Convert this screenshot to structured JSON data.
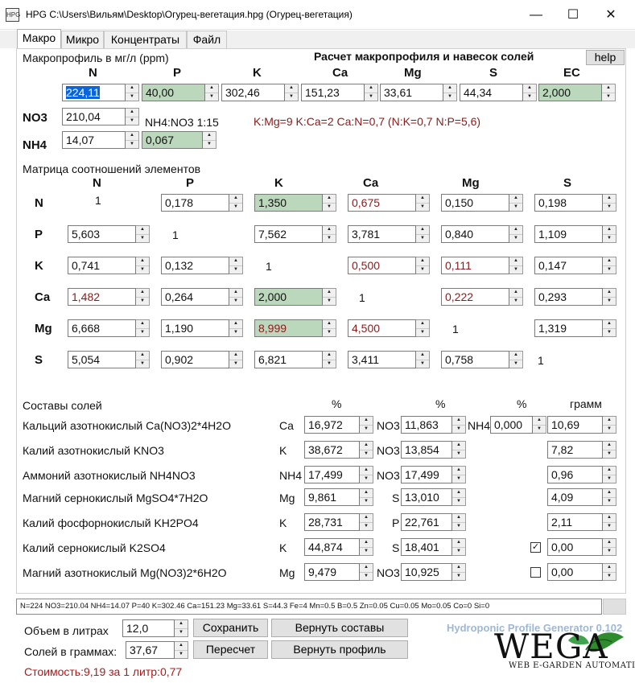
{
  "window": {
    "title": "HPG C:\\Users\\Вильям\\Desktop\\Огурец-вегетация.hpg (Огурец-вегетация)",
    "icon": "app-icon",
    "buttons": {
      "minimize": "—",
      "maximize": "☐",
      "close": "✕"
    }
  },
  "tabs": [
    "Макро",
    "Микро",
    "Концентраты",
    "Файл"
  ],
  "macro": {
    "profile_label": "Макропрофиль в мг/л (ppm)",
    "calc_title": "Расчет макропрофиля и навесок солей",
    "help_label": "help",
    "headers": [
      "N",
      "P",
      "K",
      "Ca",
      "Mg",
      "S",
      "EC"
    ],
    "values": [
      "224,11",
      "40,00",
      "302,46",
      "151,23",
      "33,61",
      "44,34",
      "2,000"
    ],
    "no3_label": "NO3",
    "no3_value": "210,04",
    "nh4_label": "NH4",
    "nh4_value": "14,07",
    "ratio_value": "0,067",
    "nh4no3_text": "NH4:NO3 1:15",
    "ratios_text": "K:Mg=9 K:Ca=2 Ca:N=0,7 (N:K=0,7 N:P=5,6)"
  },
  "matrix": {
    "label": "Матрица соотношений элементов",
    "cols": [
      "N",
      "P",
      "K",
      "Ca",
      "Mg",
      "S"
    ],
    "rows": [
      {
        "name": "N",
        "cells": [
          "1",
          "0,178",
          "1,350",
          "0,675",
          "0,150",
          "0,198"
        ]
      },
      {
        "name": "P",
        "cells": [
          "5,603",
          "1",
          "7,562",
          "3,781",
          "0,840",
          "1,109"
        ]
      },
      {
        "name": "K",
        "cells": [
          "0,741",
          "0,132",
          "1",
          "0,500",
          "0,111",
          "0,147"
        ]
      },
      {
        "name": "Ca",
        "cells": [
          "1,482",
          "0,264",
          "2,000",
          "1",
          "0,222",
          "0,293"
        ]
      },
      {
        "name": "Mg",
        "cells": [
          "6,668",
          "1,190",
          "8,999",
          "4,500",
          "1",
          "1,319"
        ]
      },
      {
        "name": "S",
        "cells": [
          "5,054",
          "0,902",
          "6,821",
          "3,411",
          "0,758",
          "1"
        ]
      }
    ]
  },
  "salts": {
    "label": "Составы солей",
    "col_pct1": "%",
    "col_pct2": "%",
    "col_pct3": "%",
    "col_gram": "грамм",
    "rows": [
      {
        "name": "Кальций азотнокислый Ca(NO3)2*4H2O",
        "el1": "Ca",
        "v1": "16,972",
        "el2": "NO3",
        "v2": "11,863",
        "el3": "NH4",
        "v3": "0,000",
        "gram": "10,69"
      },
      {
        "name": "Калий азотнокислый KNO3",
        "el1": "K",
        "v1": "38,672",
        "el2": "NO3",
        "v2": "13,854",
        "gram": "7,82"
      },
      {
        "name": "Аммоний азотнокислый NH4NO3",
        "el1": "NH4",
        "v1": "17,499",
        "el2": "NO3",
        "v2": "17,499",
        "gram": "0,96"
      },
      {
        "name": "Магний сернокислый MgSO4*7H2O",
        "el1": "Mg",
        "v1": "9,861",
        "el2": "S",
        "v2": "13,010",
        "gram": "4,09"
      },
      {
        "name": "Калий фосфорнокислый KH2PO4",
        "el1": "K",
        "v1": "28,731",
        "el2": "P",
        "v2": "22,761",
        "gram": "2,11"
      },
      {
        "name": "Калий сернокислый K2SO4",
        "el1": "K",
        "v1": "44,874",
        "el2": "S",
        "v2": "18,401",
        "check": "✓",
        "gram": "0,00"
      },
      {
        "name": "Магний азотнокислый Mg(NO3)2*6H2O",
        "el1": "Mg",
        "v1": "9,479",
        "el2": "NO3",
        "v2": "10,925",
        "check": "",
        "gram": "0,00"
      }
    ]
  },
  "status": "N=224 NO3=210.04 NH4=14.07 P=40 K=302.46 Ca=151.23 Mg=33.61 S=44.3 Fe=4 Mn=0.5 B=0.5 Zn=0.05 Cu=0.05 Mo=0.05 Co=0 Si=0",
  "bottom": {
    "volume_label": "Объем в литрах",
    "volume_value": "12,0",
    "salts_label": "Солей в граммах:",
    "salts_value": "37,67",
    "cost_text": "Стоимость:9,19 за 1 литр:0,77",
    "save": "Сохранить",
    "recalc": "Пересчет",
    "restore_salts": "Вернуть составы",
    "restore_profile": "Вернуть профиль",
    "version": "Hydroponic Profile Generator 0.102",
    "logo_word": "WEGA",
    "logo_sub": "WEB E-GARDEN AUTOMATION"
  },
  "colors": {
    "green_field": "#bcd8bc",
    "dark_red": "#8b1a1a",
    "selection": "#0a66d8"
  }
}
